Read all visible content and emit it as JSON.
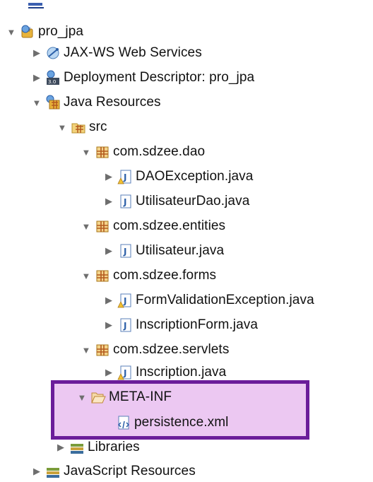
{
  "tree": {
    "project": "pro_jpa",
    "jaxws": "JAX-WS Web Services",
    "deployment": "Deployment Descriptor: pro_jpa",
    "java_resources": "Java Resources",
    "src": "src",
    "pkg_dao": "com.sdzee.dao",
    "file_daoexception": "DAOException.java",
    "file_utilisateurdao": "UtilisateurDao.java",
    "pkg_entities": "com.sdzee.entities",
    "file_utilisateur": "Utilisateur.java",
    "pkg_forms": "com.sdzee.forms",
    "file_formvalidation": "FormValidationException.java",
    "file_inscriptionform": "InscriptionForm.java",
    "pkg_servlets": "com.sdzee.servlets",
    "file_inscription": "Inscription.java",
    "meta_inf": "META-INF",
    "persistence": "persistence.xml",
    "libraries": "Libraries",
    "javascript": "JavaScript Resources"
  },
  "glyphs": {
    "expanded": "▼",
    "collapsed": "▶"
  },
  "colors": {
    "highlight_fill": "#ecc8f2",
    "highlight_border": "#6b1d9a"
  }
}
